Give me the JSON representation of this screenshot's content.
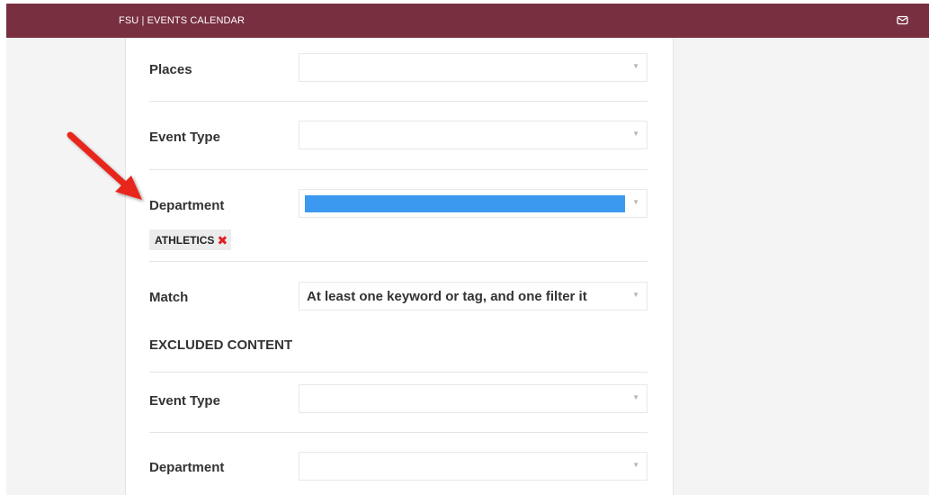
{
  "header": {
    "brand": "FSU | EVENTS CALENDAR",
    "mail_icon": "envelope-icon",
    "background": "#782f40"
  },
  "form": {
    "places": {
      "label": "Places",
      "value": ""
    },
    "event_type": {
      "label": "Event Type",
      "value": ""
    },
    "department": {
      "label": "Department",
      "selected_tags": [
        {
          "label": "ATHLETICS",
          "remove_icon": "x-icon"
        }
      ]
    },
    "match": {
      "label": "Match",
      "value": "At least one keyword or tag, and one filter it"
    },
    "excluded": {
      "heading": "EXCLUDED CONTENT",
      "event_type": {
        "label": "Event Type",
        "value": ""
      },
      "department": {
        "label": "Department",
        "value": ""
      }
    }
  },
  "annotation": {
    "arrow_icon": "red-arrow-icon",
    "arrow_color": "#e8251f"
  }
}
